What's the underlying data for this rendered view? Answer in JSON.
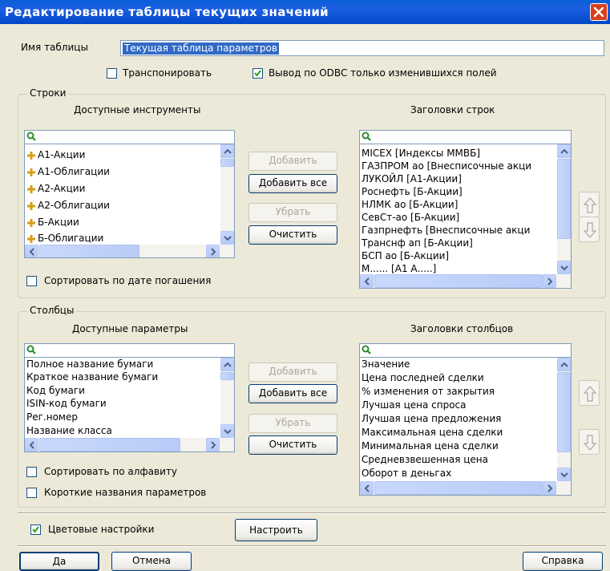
{
  "window": {
    "title": "Редактирование таблицы текущих значений"
  },
  "table_name": {
    "label": "Имя таблицы",
    "value": "Текущая таблица параметров"
  },
  "options": {
    "transpose": {
      "label": "Транспонировать",
      "checked": false
    },
    "odbc_changed_only": {
      "label": "Вывод по ODBC только изменившихся  полей",
      "checked": true
    }
  },
  "rows_group": {
    "title": "Строки",
    "available_header": "Доступные инструменты",
    "selected_header": "Заголовки строк",
    "available_items": [
      "А1-Акции",
      "А1-Облигации",
      "А2-Акции",
      "А2-Облигации",
      "Б-Акции",
      "Б-Облигации"
    ],
    "selected_items": [
      "MICEX [Индексы ММВБ]",
      "ГАЗПРОМ ао [Внесписочные акци",
      "ЛУКОЙЛ [А1-Акции]",
      "Роснефть [Б-Акции]",
      "НЛМК ао [Б-Акции]",
      "СевСт-ао [Б-Акции]",
      "Газпрнефть [Внесписочные акци",
      "Транснф ап [Б-Акции]",
      "БСП ао [Б-Акции]",
      "М...... [А1 А.....]"
    ],
    "buttons": {
      "add": "Добавить",
      "add_all": "Добавить все",
      "remove": "Убрать",
      "clear": "Очистить"
    },
    "sort_by_maturity": {
      "label": "Сортировать по дате погашения",
      "checked": false
    }
  },
  "cols_group": {
    "title": "Столбцы",
    "available_header": "Доступные параметры",
    "selected_header": "Заголовки столбцов",
    "available_items": [
      "Полное название бумаги",
      "Краткое название бумаги",
      "Код бумаги",
      "ISIN-код бумаги",
      "Рег.номер",
      "Название класса"
    ],
    "selected_items": [
      "Значение",
      "Цена последней сделки",
      "% изменения от закрытия",
      "Лучшая цена спроса",
      "Лучшая цена предложения",
      "Максимальная цена сделки",
      "Минимальная цена сделки",
      "Средневзвешенная цена",
      "Оборот в деньгах"
    ],
    "buttons": {
      "add": "Добавить",
      "add_all": "Добавить все",
      "remove": "Убрать",
      "clear": "Очистить"
    },
    "sort_alpha": {
      "label": "Сортировать по алфавиту",
      "checked": false
    },
    "short_names": {
      "label": "Короткие названия параметров",
      "checked": false
    }
  },
  "color_settings": {
    "label": "Цветовые настройки",
    "checked": true,
    "configure": "Настроить"
  },
  "footer": {
    "ok": "Да",
    "cancel": "Отмена",
    "help": "Справка"
  },
  "colors": {
    "titlebar": "#0a5fd8",
    "selection": "#316ac5",
    "dialog_bg": "#ece9d8"
  }
}
